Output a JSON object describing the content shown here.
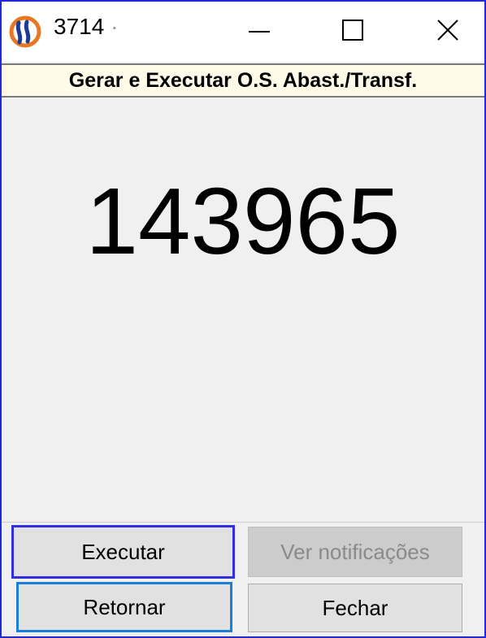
{
  "window": {
    "title": "3714",
    "title_suffix": "·",
    "subtitle": "Gerar e Executar O.S. Abast./Transf.",
    "border_color": "#1f2bd6"
  },
  "main": {
    "number": "143965"
  },
  "buttons": {
    "executar": "Executar",
    "ver_notificacoes": "Ver notificações",
    "retornar": "Retornar",
    "fechar": "Fechar"
  },
  "icons": {
    "app": "app-logo-icon",
    "minimize": "minimize-icon",
    "maximize": "maximize-icon",
    "close": "close-icon"
  },
  "colors": {
    "logo_orange": "#e87722",
    "logo_blue": "#1f3a93",
    "subtitle_bg": "#fffbe8",
    "focus_blue": "#2f2fe0"
  }
}
